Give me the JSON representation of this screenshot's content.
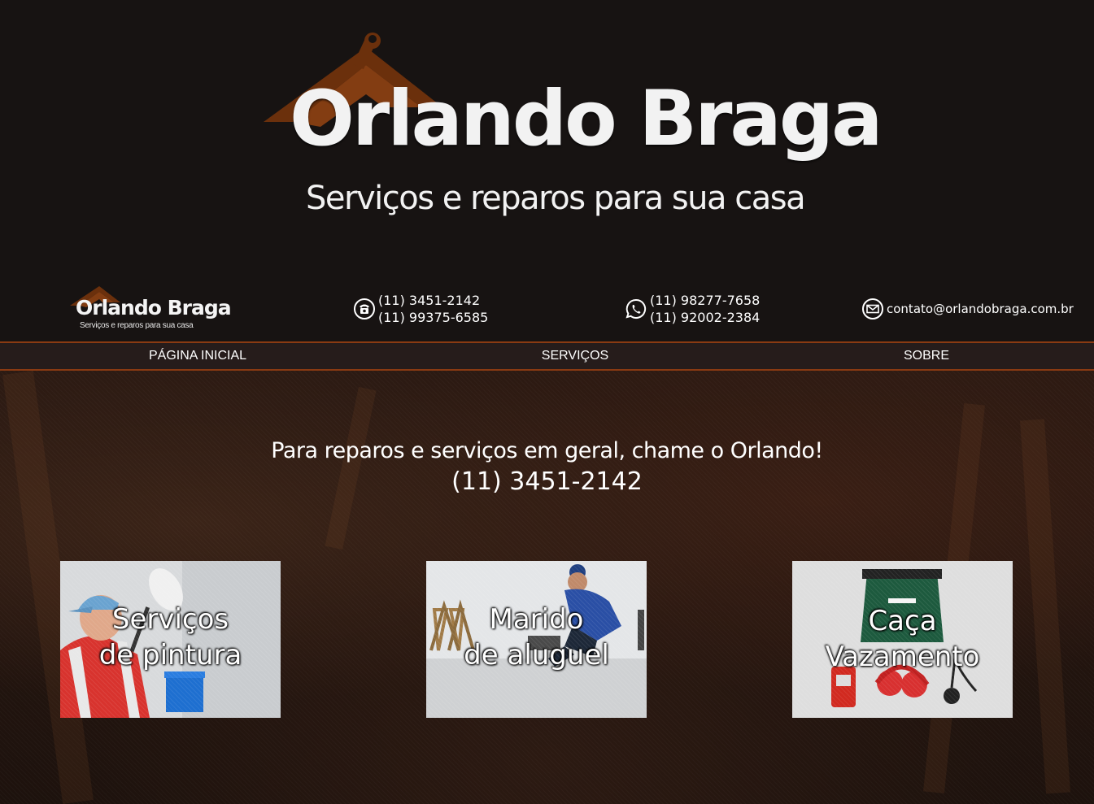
{
  "brand": {
    "name": "Orlando Braga",
    "tagline": "Serviços e reparos para sua casa",
    "roof_color": "#7a3a10"
  },
  "contacts": {
    "phone": {
      "icon": "telephone-icon",
      "lines": [
        "(11) 3451-2142",
        "(11) 99375-6585"
      ]
    },
    "whatsapp": {
      "icon": "whatsapp-icon",
      "lines": [
        "(11) 98277-7658",
        "(11) 92002-2384"
      ]
    },
    "email": {
      "icon": "envelope-icon",
      "address": "contato@orlandobraga.com.br"
    }
  },
  "nav": {
    "items": [
      "PÁGINA INICIAL",
      "SERVIÇOS",
      "SOBRE"
    ],
    "accent_color": "#8a3a12"
  },
  "main": {
    "headline": "Para reparos e serviços em geral, chame o Orlando!",
    "phone": "(11) 3451-2142"
  },
  "services": [
    {
      "line1": "Serviços",
      "line2": "de pintura"
    },
    {
      "line1": "Marido",
      "line2": "de aluguel"
    },
    {
      "line1": "Caça",
      "line2": "Vazamento"
    }
  ]
}
